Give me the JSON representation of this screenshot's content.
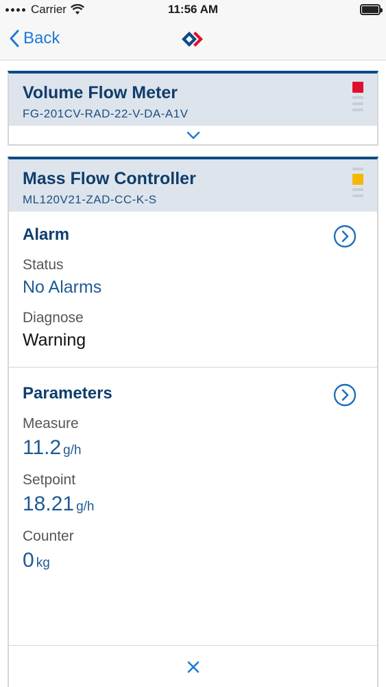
{
  "status_bar": {
    "carrier": "Carrier",
    "time": "11:56 AM"
  },
  "nav": {
    "back_label": "Back"
  },
  "devices": [
    {
      "title": "Volume Flow Meter",
      "code": "FG-201CV-RAD-22-V-DA-A1V",
      "status_color": "#e0102c"
    },
    {
      "title": "Mass Flow Controller",
      "code": "ML120V21-ZAD-CC-K-S",
      "status_color": "#f5b800"
    }
  ],
  "alarm": {
    "title": "Alarm",
    "status_label": "Status",
    "status_value": "No Alarms",
    "diagnose_label": "Diagnose",
    "diagnose_value": "Warning"
  },
  "parameters": {
    "title": "Parameters",
    "measure_label": "Measure",
    "measure_value": "11.2",
    "measure_unit": "g/h",
    "setpoint_label": "Setpoint",
    "setpoint_value": "18.21",
    "setpoint_unit": "g/h",
    "counter_label": "Counter",
    "counter_value": "0",
    "counter_unit": "kg"
  },
  "colors": {
    "accent": "#1e79d4",
    "header_bg": "#dde4ec",
    "brand_blue": "#0a4a87"
  }
}
